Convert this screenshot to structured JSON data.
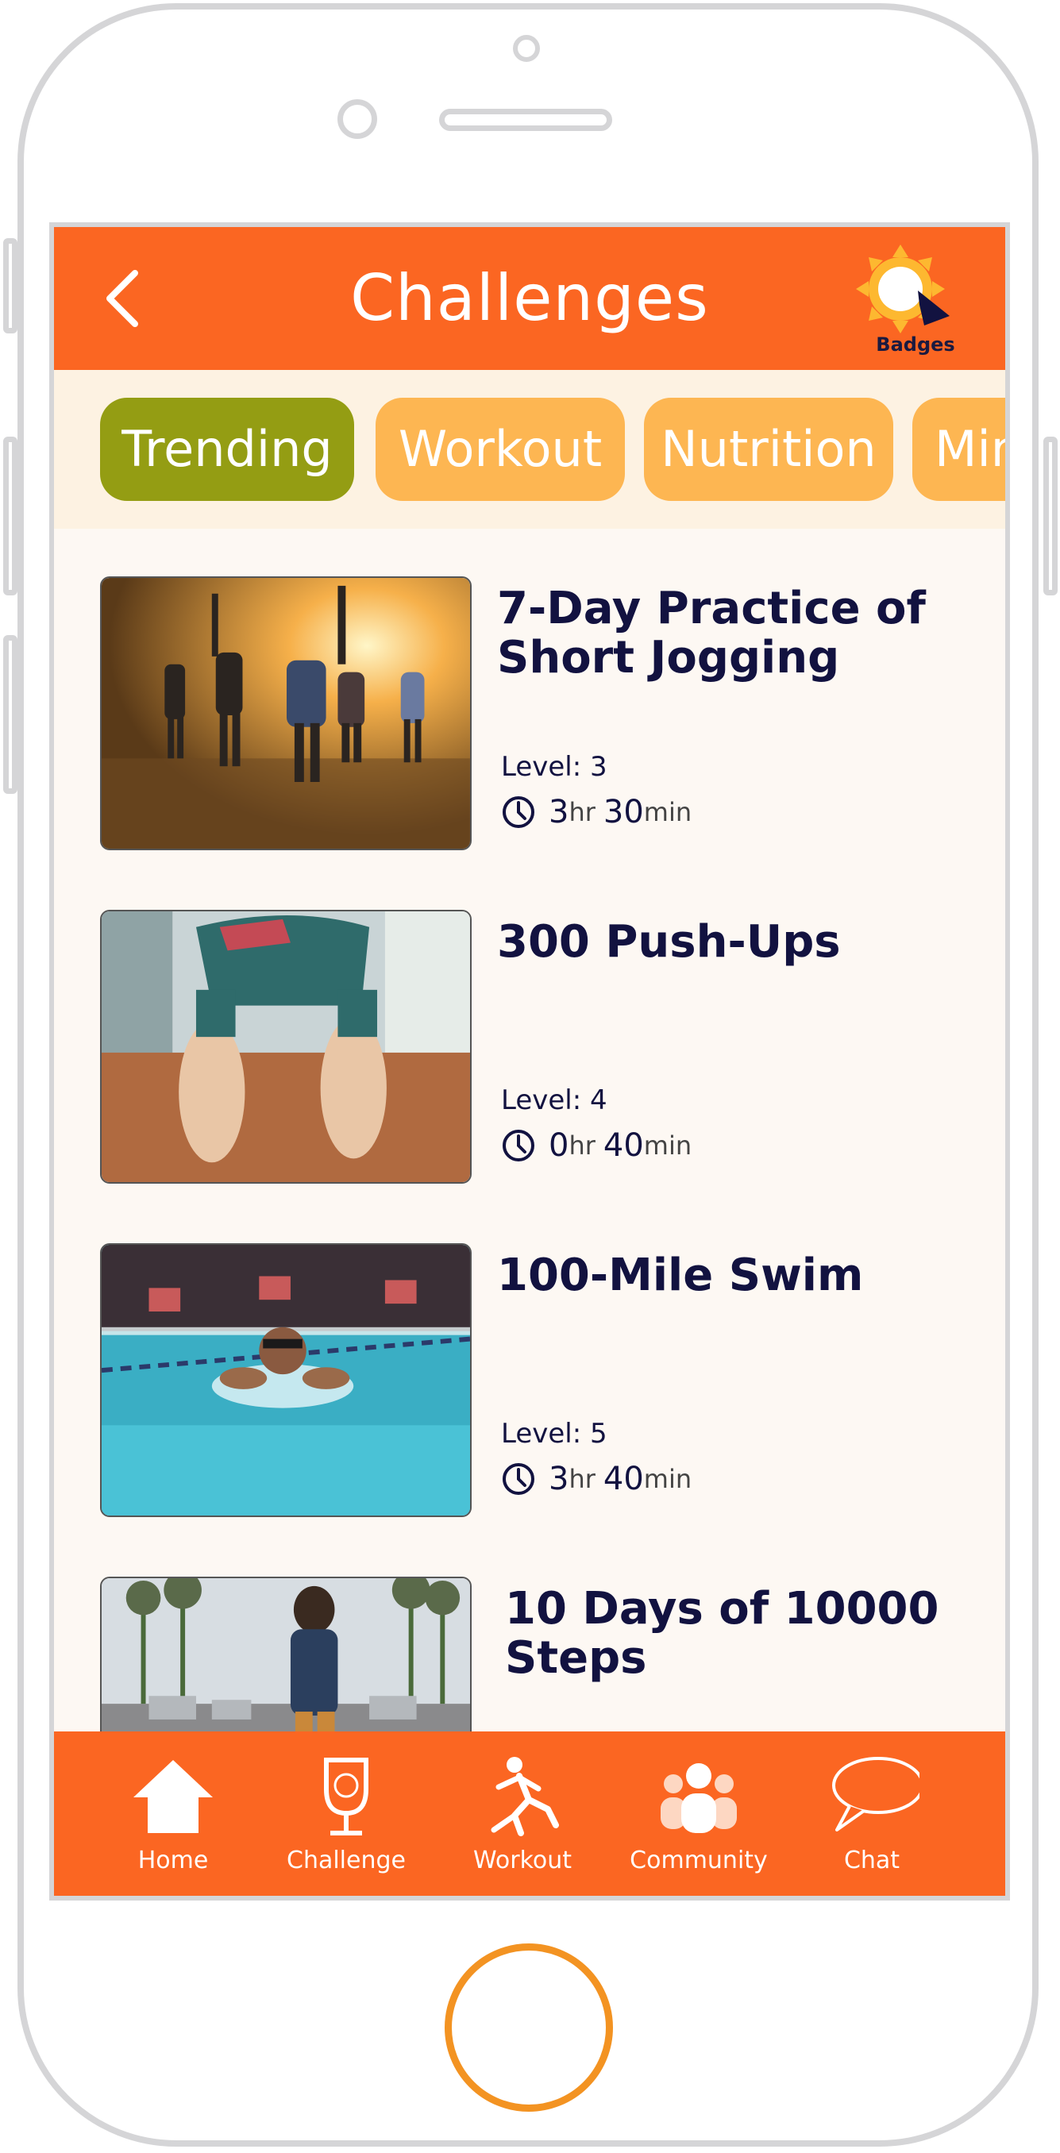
{
  "header": {
    "title": "Challenges",
    "badges_label": "Badges"
  },
  "tabs": [
    {
      "label": "Trending",
      "active": true
    },
    {
      "label": "Workout",
      "active": false
    },
    {
      "label": "Nutrition",
      "active": false
    },
    {
      "label": "Mindfulness",
      "active": false
    }
  ],
  "challenges": [
    {
      "title": "7-Day Practice of Short Jogging",
      "level": "Level: 3",
      "hours": "3",
      "hr_unit": "hr",
      "minutes": "30",
      "min_unit": "min",
      "image": "group-jogging-photo"
    },
    {
      "title": "300 Push-Ups",
      "level": "Level: 4",
      "hours": "0",
      "hr_unit": "hr",
      "minutes": "40",
      "min_unit": "min",
      "image": "push-up-feet-photo"
    },
    {
      "title": "100-Mile Swim",
      "level": "Level: 5",
      "hours": "3",
      "hr_unit": "hr",
      "minutes": "40",
      "min_unit": "min",
      "image": "swimmer-pool-photo"
    },
    {
      "title": "10 Days of 10000 Steps",
      "image": "street-walking-photo"
    }
  ],
  "navbar": [
    {
      "label": "Home",
      "icon": "home-icon"
    },
    {
      "label": "Challenge",
      "icon": "trophy-icon"
    },
    {
      "label": "Workout",
      "icon": "runner-icon"
    },
    {
      "label": "Community",
      "icon": "community-icon"
    },
    {
      "label": "Chat",
      "icon": "chat-bubble-icon"
    }
  ],
  "colors": {
    "brand_orange": "#fb6622",
    "tab_inactive": "#fdb652",
    "tab_active": "#949d13",
    "text_dark": "#121240",
    "home_button": "#f39322"
  }
}
